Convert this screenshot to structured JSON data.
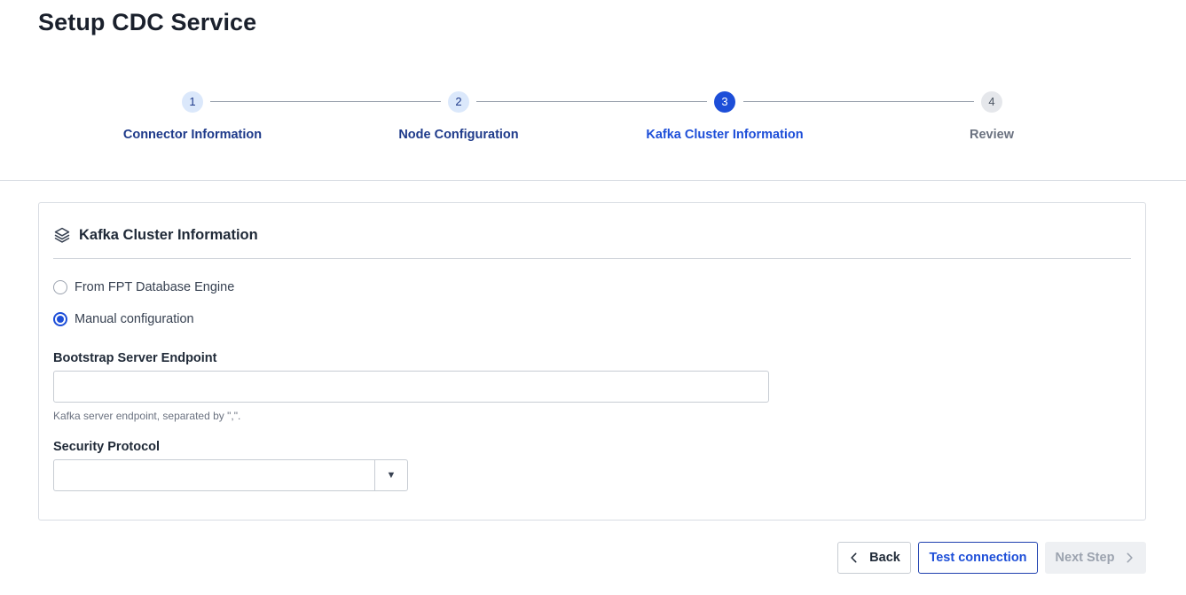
{
  "page": {
    "title": "Setup CDC Service"
  },
  "stepper": {
    "steps": [
      {
        "number": "1",
        "label": "Connector Information",
        "state": "done"
      },
      {
        "number": "2",
        "label": "Node Configuration",
        "state": "done"
      },
      {
        "number": "3",
        "label": "Kafka Cluster Information",
        "state": "active"
      },
      {
        "number": "4",
        "label": "Review",
        "state": "pending"
      }
    ]
  },
  "card": {
    "icon": "layers-icon",
    "title": "Kafka Cluster Information",
    "source_options": [
      {
        "label": "From FPT Database Engine",
        "checked": false
      },
      {
        "label": "Manual configuration",
        "checked": true
      }
    ],
    "bootstrap": {
      "label": "Bootstrap Server Endpoint",
      "value": "",
      "help": "Kafka server endpoint, separated by \",\"."
    },
    "security": {
      "label": "Security Protocol",
      "value": "",
      "arrow": "▼"
    }
  },
  "footer": {
    "back_label": "Back",
    "test_label": "Test connection",
    "next_label": "Next Step"
  },
  "colors": {
    "primary": "#1d4ed8",
    "done_circle": "#dbe8fb",
    "disabled_bg": "#eef0f3"
  }
}
